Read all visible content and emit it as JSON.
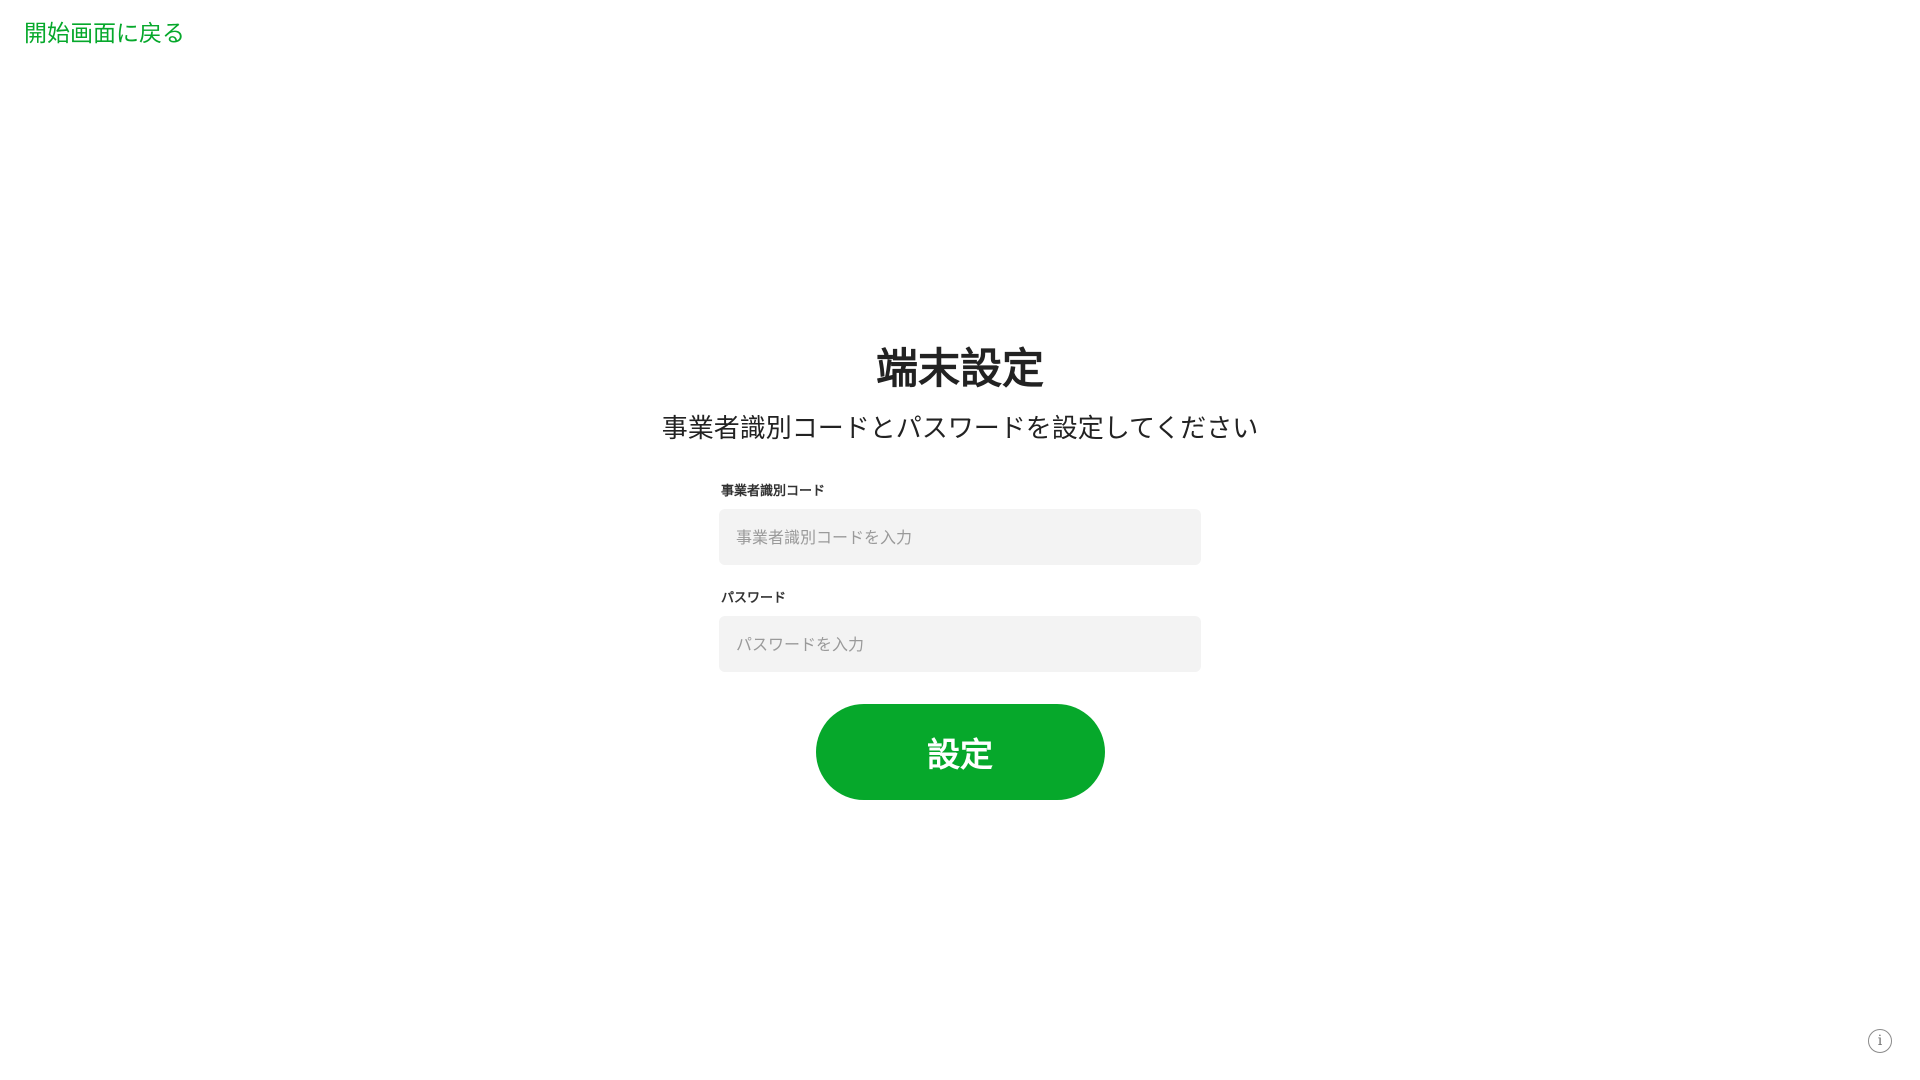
{
  "header": {
    "back_link_label": "開始画面に戻る"
  },
  "main": {
    "title": "端末設定",
    "subtitle": "事業者識別コードとパスワードを設定してください",
    "fields": [
      {
        "label": "事業者識別コード",
        "value": "",
        "placeholder": "事業者識別コードを入力"
      },
      {
        "label": "パスワード",
        "value": "",
        "placeholder": "パスワードを入力"
      }
    ],
    "submit_label": "設定"
  },
  "footer": {
    "info_icon": "info-icon",
    "info_glyph": "i"
  },
  "colors": {
    "accent": "#06a82b",
    "input_background": "#f3f3f3",
    "text": "#222222"
  }
}
